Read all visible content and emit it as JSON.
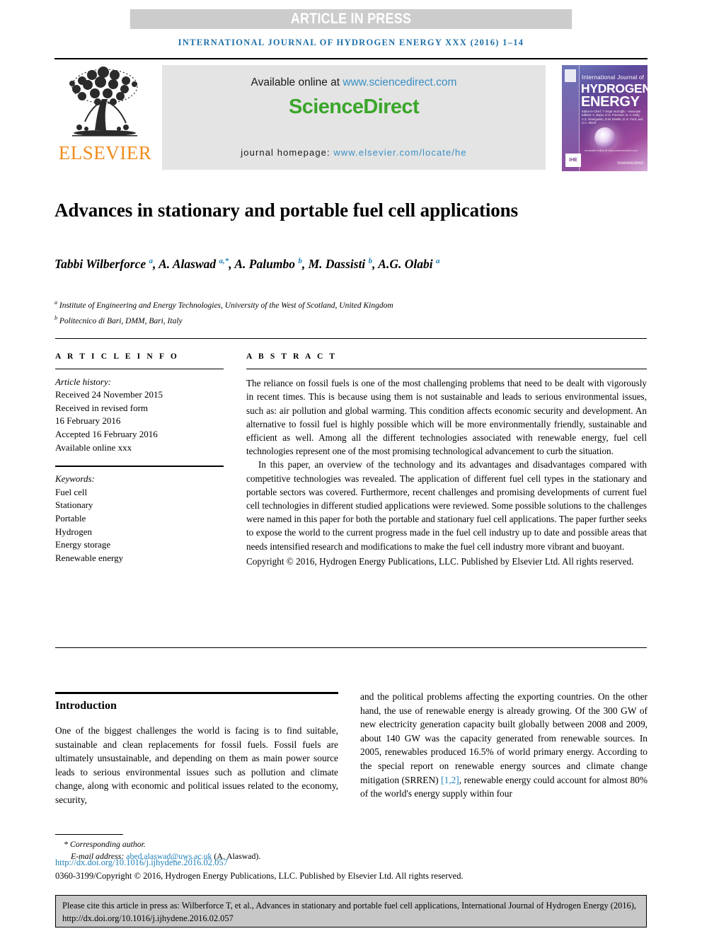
{
  "press_banner": "ARTICLE IN PRESS",
  "running_head": "INTERNATIONAL JOURNAL OF HYDROGEN ENERGY XXX (2016) 1–14",
  "masthead": {
    "publisher": "ELSEVIER",
    "available_prefix": "Available online at ",
    "available_link": "www.sciencedirect.com",
    "sciencedirect_logo": "ScienceDirect",
    "homepage_label": "journal homepage: ",
    "homepage_link": "www.elsevier.com/locate/he",
    "cover": {
      "line1": "International Journal of",
      "line2": "HYDROGEN",
      "line3": "ENERGY",
      "editors": "Editor-in-Chief: T. Nejat Veziroğlu · Associate Editors: A. Bejan, D.G. Freeman, N. A. Kelly, A.Z. Abuelgasim, D.W. DeWitt, D. E. Ford, and S.A. Sherif",
      "tagline": "Available online at www.sciencedirect.com",
      "badge": "IHE",
      "sciencedirect": "ScienceDirect"
    }
  },
  "article": {
    "title": "Advances in stationary and portable fuel cell applications",
    "authors_html": "Tabbi Wilberforce <sup>a</sup>, A. Alaswad <sup>a,*</sup>, A. Palumbo <sup>b</sup>, M. Dassisti <sup>b</sup>, A.G. Olabi <sup>a</sup>",
    "affiliations": [
      {
        "marker": "a",
        "text": "Institute of Engineering and Energy Technologies, University of the West of Scotland, United Kingdom"
      },
      {
        "marker": "b",
        "text": "Politecnico di Bari, DMM, Bari, Italy"
      }
    ]
  },
  "article_info": {
    "heading": "A R T I C L E  I N F O",
    "history_label": "Article history:",
    "history": [
      "Received 24 November 2015",
      "Received in revised form",
      "16 February 2016",
      "Accepted 16 February 2016",
      "Available online xxx"
    ],
    "keywords_label": "Keywords:",
    "keywords": [
      "Fuel cell",
      "Stationary",
      "Portable",
      "Hydrogen",
      "Energy storage",
      "Renewable energy"
    ]
  },
  "abstract": {
    "heading": "A B S T R A C T",
    "paragraphs": [
      "The reliance on fossil fuels is one of the most challenging problems that need to be dealt with vigorously in recent times. This is because using them is not sustainable and leads to serious environmental issues, such as: air pollution and global warming. This condition affects economic security and development. An alternative to fossil fuel is highly possible which will be more environmentally friendly, sustainable and efficient as well. Among all the different technologies associated with renewable energy, fuel cell technologies represent one of the most promising technological advancement to curb the situation.",
      "In this paper, an overview of the technology and its advantages and disadvantages compared with competitive technologies was revealed. The application of different fuel cell types in the stationary and portable sectors was covered. Furthermore, recent challenges and promising developments of current fuel cell technologies in different studied applications were reviewed. Some possible solutions to the challenges were named in this paper for both the portable and stationary fuel cell applications. The paper further seeks to expose the world to the current progress made in the fuel cell industry up to date and possible areas that needs intensified research and modifications to make the fuel cell industry more vibrant and buoyant."
    ],
    "copyright": "Copyright © 2016, Hydrogen Energy Publications, LLC. Published by Elsevier Ltd. All rights reserved."
  },
  "body": {
    "intro_heading": "Introduction",
    "left_column": "One of the biggest challenges the world is facing is to find suitable, sustainable and clean replacements for fossil fuels. Fossil fuels are ultimately unsustainable, and depending on them as main power source leads to serious environmental issues such as pollution and climate change, along with economic and political issues related to the economy, security,",
    "right_column_part1": "and the political problems affecting the exporting countries. On the other hand, the use of renewable energy is already growing. Of the 300 GW of new electricity generation capacity built globally between 2008 and 2009, about 140 GW was the capacity generated from renewable sources. In 2005, renewables produced 16.5% of world primary energy. According to the special report on renewable energy sources and climate change mitigation (SRREN) ",
    "right_column_citation": "[1,2]",
    "right_column_part2": ", renewable energy could account for almost 80% of the world's energy supply within four"
  },
  "footer": {
    "corresponding_marker": "*",
    "corresponding_label": "Corresponding author.",
    "email_label": "E-mail address: ",
    "email": "abed.alaswad@uws.ac.uk",
    "email_suffix": " (A. Alaswad).",
    "doi": "http://dx.doi.org/10.1016/j.ijhydene.2016.02.057",
    "issn_line": "0360-3199/Copyright © 2016, Hydrogen Energy Publications, LLC. Published by Elsevier Ltd. All rights reserved.",
    "citation_box": "Please cite this article in press as: Wilberforce T, et al., Advances in stationary and portable fuel cell applications, International Journal of Hydrogen Energy (2016), http://dx.doi.org/10.1016/j.ijhydene.2016.02.057"
  },
  "colors": {
    "link_blue": "#1f7fb8",
    "elsevier_orange": "#F08C1E",
    "sciencedirect_green": "#3aa62a",
    "press_band_gray": "#cccccc",
    "banner_gray": "#e4e4e4",
    "cite_box_gray": "#c7c7c7"
  }
}
